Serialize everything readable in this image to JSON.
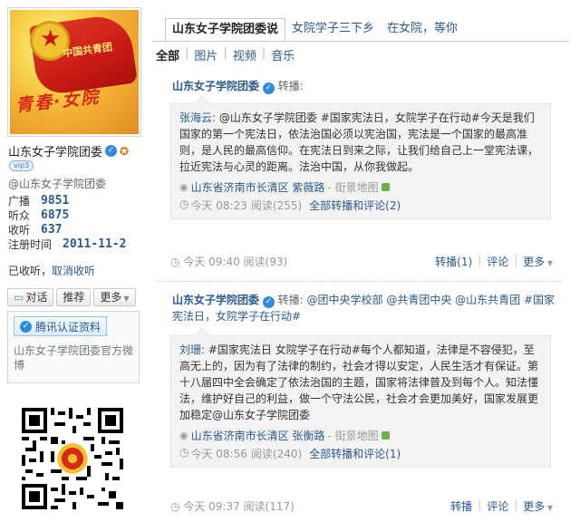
{
  "profile": {
    "avatar_flag_text": "中国共青团",
    "avatar_slogan": "青春·女院",
    "name": "山东女子学院团委",
    "vip_label": "vip3",
    "handle": "@山东女子学院团委",
    "stats": [
      {
        "label": "广播",
        "value": "9851"
      },
      {
        "label": "听众",
        "value": "6875"
      },
      {
        "label": "收听",
        "value": "637"
      },
      {
        "label": "注册时间",
        "value": "2011-11-2"
      }
    ],
    "follow_status": "已收听",
    "unfollow_label": "取消收听",
    "actions": {
      "chat": "对话",
      "recommend": "推荐",
      "more": "更多"
    },
    "verify_button": "腾讯认证资料",
    "verify_text": "山东女子学院团委官方微博"
  },
  "tabs": [
    "山东女子学院团委说",
    "女院学子三下乡",
    "在女院，等你"
  ],
  "filters": [
    "全部",
    "图片",
    "视频",
    "音乐"
  ],
  "posts": [
    {
      "author": "山东女子学院团委",
      "rt_label": "转播:",
      "comment": "",
      "quote_author": "张海云:",
      "quote_body": "@山东女子学院团委 #国家宪法日，女院学子在行动#今天是我们国家的第一个宪法日，依法治国必须以宪治国，宪法是一个国家的最高准则，是人民的最高信仰。在宪法日到来之际，让我们给自己上一堂宪法课，拉近宪法与心灵的距离。法治中国，从你我做起。",
      "location": "山东省济南市长清区 紫薇路",
      "map_label": "- 街景地图",
      "quote_time": "今天 08:23",
      "quote_reads": "阅读(255)",
      "quote_all": "全部转播和评论(2)",
      "time": "今天 09:40",
      "reads": "阅读(93)",
      "forward": "转播(1)",
      "comment_btn": "评论",
      "more": "更多"
    },
    {
      "author": "山东女子学院团委",
      "rt_label": "转播:",
      "comment": "@团中央学校部 @共青团中央 @山东共青团 #国家宪法日，女院学子在行动#",
      "quote_author": "刘珊:",
      "quote_body": "#国家宪法日 女院学子在行动#每个人都知道，法律是不容侵犯，至高无上的，因为有了法律的制约，社会才得以安定，人民生活才有保证。第十八届四中全会确定了依法治国的主题，国家将法律普及到每个人。知法懂法，维护好自己的利益，做一个守法公民，社会才会更加美好，国家发展更加稳定@山东女子学院团委",
      "location": "山东省济南市长清区 张衡路",
      "map_label": "- 街景地图",
      "quote_time": "今天 08:56",
      "quote_reads": "阅读(240)",
      "quote_all": "全部转播和评论(1)",
      "time": "今天 09:37",
      "reads": "阅读(117)",
      "forward": "转播",
      "comment_btn": "评论",
      "more": "更多"
    }
  ],
  "colors": {
    "link": "#2b5a8f",
    "muted": "#999999",
    "quote_bg": "#f3f3f3"
  }
}
